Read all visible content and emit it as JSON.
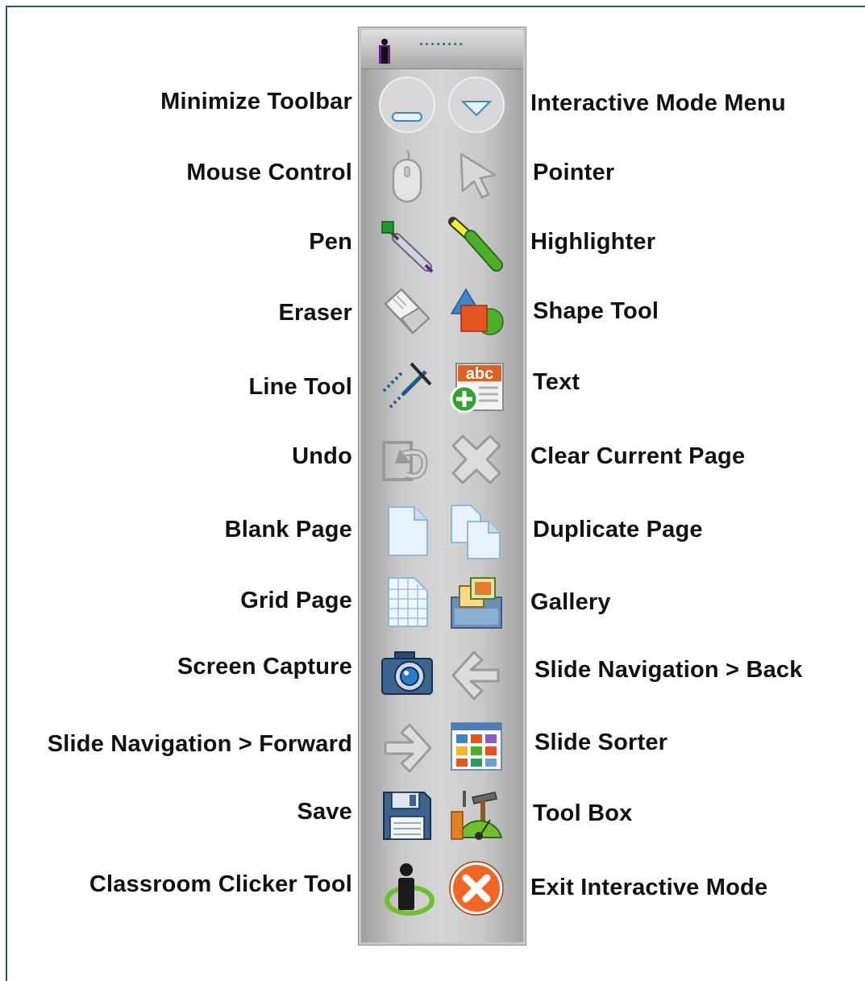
{
  "toolbar": {
    "grip_label": "········",
    "buttons": [
      {
        "label": "Minimize Toolbar",
        "icon": "minimize-icon"
      },
      {
        "label": "Interactive Mode Menu",
        "icon": "chevron-down-icon"
      },
      {
        "label": "Mouse Control",
        "icon": "mouse-icon"
      },
      {
        "label": "Pointer",
        "icon": "pointer-icon"
      },
      {
        "label": "Pen",
        "icon": "pen-icon"
      },
      {
        "label": "Highlighter",
        "icon": "highlighter-icon"
      },
      {
        "label": "Eraser",
        "icon": "eraser-icon"
      },
      {
        "label": "Shape Tool",
        "icon": "shapes-icon"
      },
      {
        "label": "Line Tool",
        "icon": "line-tool-icon"
      },
      {
        "label": "Text",
        "icon": "text-abc-icon"
      },
      {
        "label": "Undo",
        "icon": "undo-icon"
      },
      {
        "label": "Clear Current Page",
        "icon": "clear-x-icon"
      },
      {
        "label": "Blank Page",
        "icon": "blank-page-icon"
      },
      {
        "label": "Duplicate Page",
        "icon": "duplicate-page-icon"
      },
      {
        "label": "Grid Page",
        "icon": "grid-page-icon"
      },
      {
        "label": "Gallery",
        "icon": "gallery-icon"
      },
      {
        "label": "Screen Capture",
        "icon": "camera-icon"
      },
      {
        "label": "Slide Navigation > Back",
        "icon": "arrow-left-icon"
      },
      {
        "label": "Slide Navigation > Forward",
        "icon": "arrow-right-icon"
      },
      {
        "label": "Slide Sorter",
        "icon": "slide-sorter-icon"
      },
      {
        "label": "Save",
        "icon": "floppy-disk-icon"
      },
      {
        "label": "Tool Box",
        "icon": "toolbox-icon"
      },
      {
        "label": "Classroom Clicker Tool",
        "icon": "clicker-icon"
      },
      {
        "label": "Exit Interactive Mode",
        "icon": "exit-icon"
      }
    ]
  },
  "colors": {
    "frame_border": "#2f4f76",
    "exit_orange": "#f26522",
    "highlighter_green": "#4caf2a",
    "highlighter_yellow": "#f4ee2a",
    "icon_blue": "#3a86c9"
  }
}
